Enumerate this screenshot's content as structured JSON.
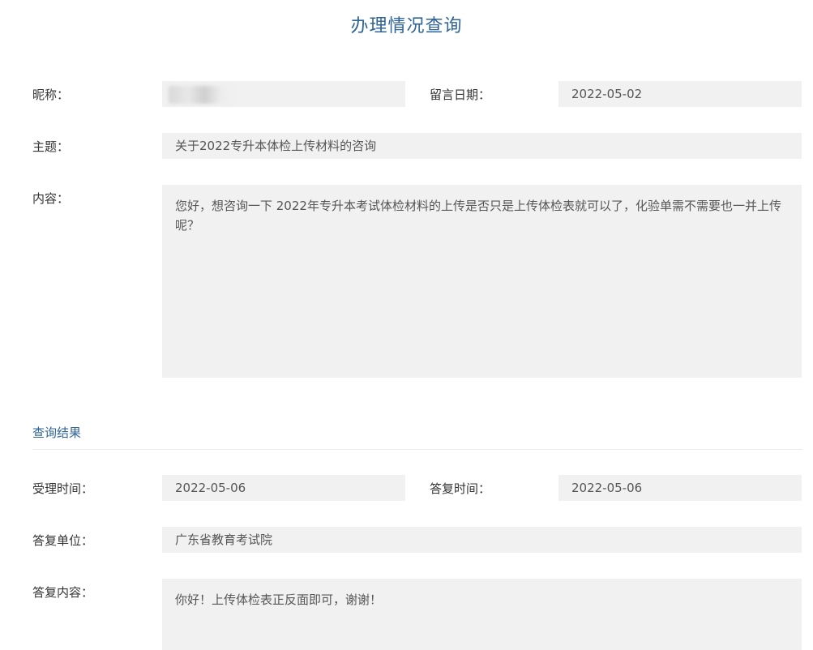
{
  "page": {
    "title": "办理情况查询"
  },
  "form": {
    "nickname_label": "昵称：",
    "date_label": "留言日期：",
    "date_value": "2022-05-02",
    "subject_label": "主题：",
    "subject_value": "关于2022专升本体检上传材料的咨询",
    "content_label": "内容：",
    "content_value": "您好，想咨询一下 2022年专升本考试体检材料的上传是否只是上传体检表就可以了，化验单需不需要也一并上传呢？"
  },
  "result": {
    "section_title": "查询结果",
    "accept_time_label": "受理时间：",
    "accept_time_value": "2022-05-06",
    "reply_time_label": "答复时间：",
    "reply_time_value": "2022-05-06",
    "reply_unit_label": "答复单位：",
    "reply_unit_value": "广东省教育考试院",
    "reply_content_label": "答复内容：",
    "reply_content_value": "你好！上传体检表正反面即可，谢谢！"
  },
  "colors": {
    "accent": "#2f6496",
    "field_bg": "#f1f1f1"
  }
}
